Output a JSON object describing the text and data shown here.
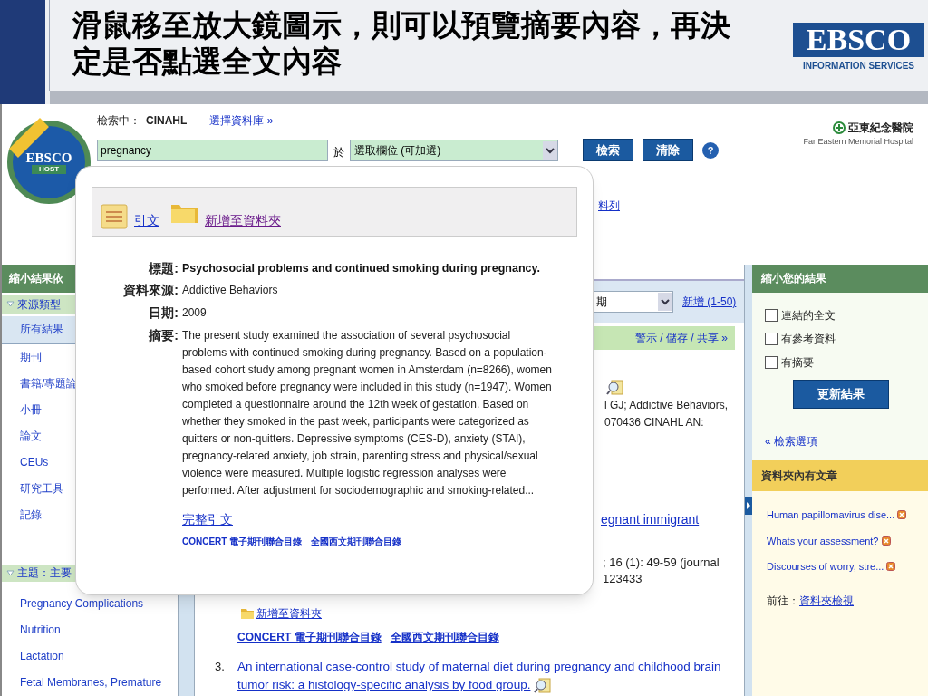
{
  "slide": {
    "title": "滑鼠移至放大鏡圖示，則可以預覽摘要內容，再決定是否點選全文內容",
    "logo_name": "EBSCO",
    "logo_tagline": "INFORMATION SERVICES"
  },
  "app_logo": {
    "name": "EBSCO",
    "sub": "HOST"
  },
  "search": {
    "label": "檢索中：",
    "database": "CINAHL",
    "choose_link": "選擇資料庫 »",
    "query": "pregnancy",
    "in_label": "於",
    "field_select": "選取欄位 (可加選)",
    "buttons": [
      "檢索",
      "清除"
    ],
    "help": "?"
  },
  "hospital": {
    "name": "亞東紀念醫院",
    "english": "Far Eastern Memorial Hospital"
  },
  "header_link_fragment": "料列",
  "left_panel": {
    "title": "縮小結果依",
    "sections": [
      {
        "title": "來源類型",
        "expanded": true,
        "items": [
          {
            "label": "所有結果",
            "selected": true
          },
          {
            "label": "期刊",
            "selected": false
          },
          {
            "label": "書籍/專題論",
            "selected": false
          },
          {
            "label": "小冊",
            "selected": false
          },
          {
            "label": "論文",
            "selected": false
          },
          {
            "label": "CEUs",
            "selected": false
          },
          {
            "label": "研究工具",
            "selected": false
          },
          {
            "label": "記錄",
            "selected": false
          }
        ]
      },
      {
        "title": "主題：主要",
        "expanded": true,
        "items": [
          {
            "label": "Pregnancy Complications",
            "selected": false
          },
          {
            "label": "Nutrition",
            "selected": false
          },
          {
            "label": "Lactation",
            "selected": false
          },
          {
            "label": "Fetal Membranes, Premature",
            "selected": false
          }
        ]
      }
    ]
  },
  "results": {
    "sort_fragment": "期",
    "add_link": "新增 (1-50)",
    "toolbar_link": "警示 / 儲存 / 共享 »",
    "result1_fragments": [
      "l GJ; Addictive Behaviors,",
      "070436 CINAHL AN:"
    ],
    "result2_title_fragment": "egnant immigrant",
    "result2_fragments": [
      "; 16 (1): 49-59 (journal",
      "123433"
    ],
    "result2_folder_link": "新增至資料夾",
    "result2_catalogs": [
      "CONCERT 電子期刊聯合目錄",
      "全國西文期刊聯合目錄"
    ],
    "result3": {
      "number": "3.",
      "title": "An international case-control study of maternal diet during pregnancy and childhood brain tumor risk: a histology-specific analysis by food group."
    }
  },
  "right_panel": {
    "title": "縮小您的結果",
    "filters": [
      {
        "label": "連結的全文",
        "checked": false
      },
      {
        "label": "有參考資料",
        "checked": false
      },
      {
        "label": "有摘要",
        "checked": false
      }
    ],
    "update_button": "更新結果",
    "options_link": "« 檢索選項",
    "folder": {
      "title": "資料夾內有文章",
      "items": [
        "Human papillomavirus dise...",
        "Whats your assessment?",
        "Discourses of worry, stre..."
      ],
      "go_label": "前往：",
      "view_link": "資料夾檢視"
    }
  },
  "preview": {
    "actions": [
      "引文",
      "新增至資料夾"
    ],
    "fields": [
      {
        "label": "標題:",
        "value": "Psychosocial problems and continued smoking during pregnancy.",
        "kind": "title"
      },
      {
        "label": "資料來源:",
        "value": "Addictive Behaviors",
        "kind": "text"
      },
      {
        "label": "日期:",
        "value": "2009",
        "kind": "text"
      },
      {
        "label": "摘要:",
        "value": "The present study examined the association of several psychosocial problems with continued smoking during pregnancy. Based on a population-based cohort study among pregnant women in Amsterdam (n=8266), women who smoked before pregnancy were included in this study (n=1947). Women completed a questionnaire around the 12th week of gestation. Based on whether they smoked in the past week, participants were categorized as quitters or non-quitters. Depressive symptoms (CES-D), anxiety (STAI), pregnancy-related anxiety, job strain, parenting stress and physical/sexual violence were measured. Multiple logistic regression analyses were performed. After adjustment for sociodemographic and smoking-related...",
        "kind": "text"
      }
    ],
    "full_link": "完整引文",
    "catalogs": [
      "CONCERT 電子期刊聯合目錄",
      "全國西文期刊聯合目錄"
    ]
  }
}
